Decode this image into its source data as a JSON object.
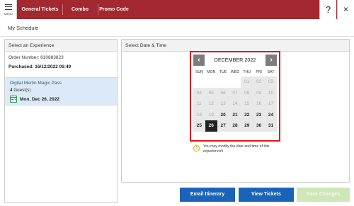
{
  "header": {
    "menu_label": "MENU",
    "tabs": [
      {
        "label": "General Tickets"
      },
      {
        "label": "Combo Tickets"
      },
      {
        "label": "Promo Code"
      }
    ],
    "help_label": "?",
    "close_label": "×"
  },
  "page": {
    "title": "My Schedule"
  },
  "left_panel": {
    "heading": "Select an Experience",
    "order_number": "Order Number: 610883823",
    "purchased": "Purchased: 16/12/2022 06:49",
    "experience": {
      "name": "Digital Merlin Magic Pass",
      "guest_count": "4",
      "guest_suffix": " Guest(s)",
      "date": "Mon, Dec 26, 2022"
    }
  },
  "right_panel": {
    "heading": "Select Date & Time",
    "calendar": {
      "month": "DECEMBER 2022",
      "prev": "‹",
      "next": "›",
      "weekdays": [
        "SUN",
        "MON",
        "TUE",
        "WED",
        "THU",
        "FRI",
        "SAT"
      ],
      "weeks": [
        [
          {
            "d": ""
          },
          {
            "d": ""
          },
          {
            "d": ""
          },
          {
            "d": ""
          },
          {
            "d": "01",
            "s": "disabled"
          },
          {
            "d": "02",
            "s": "disabled"
          },
          {
            "d": "03",
            "s": "disabled"
          }
        ],
        [
          {
            "d": "04",
            "s": "disabled"
          },
          {
            "d": "05",
            "s": "disabled"
          },
          {
            "d": "06",
            "s": "disabled"
          },
          {
            "d": "07",
            "s": "disabled"
          },
          {
            "d": "08",
            "s": "disabled"
          },
          {
            "d": "09",
            "s": "disabled"
          },
          {
            "d": "10",
            "s": "disabled"
          }
        ],
        [
          {
            "d": "11",
            "s": "disabled"
          },
          {
            "d": "12",
            "s": "disabled"
          },
          {
            "d": "13",
            "s": "disabled"
          },
          {
            "d": "14",
            "s": "disabled"
          },
          {
            "d": "15",
            "s": "disabled"
          },
          {
            "d": "16",
            "s": "disabled"
          },
          {
            "d": "17",
            "s": "disabled"
          }
        ],
        [
          {
            "d": "18",
            "s": "disabled"
          },
          {
            "d": "19",
            "s": "disabled"
          },
          {
            "d": "20",
            "s": "available"
          },
          {
            "d": "21",
            "s": "available"
          },
          {
            "d": "22",
            "s": "available"
          },
          {
            "d": "23",
            "s": "available"
          },
          {
            "d": "24",
            "s": "available"
          }
        ],
        [
          {
            "d": "25",
            "s": "available"
          },
          {
            "d": "26",
            "s": "selected"
          },
          {
            "d": "27",
            "s": "available"
          },
          {
            "d": "28",
            "s": "available"
          },
          {
            "d": "29",
            "s": "available"
          },
          {
            "d": "30",
            "s": "available"
          },
          {
            "d": "31",
            "s": "available"
          }
        ]
      ]
    },
    "info_text": "You may modify the date and time of this experience5"
  },
  "footer": {
    "email_label": "Email Itinerary",
    "view_label": "View Tickets",
    "save_label": "Save Changes"
  },
  "colors": {
    "header_bg": "#a4282f",
    "primary_button": "#1a63b8",
    "disabled_button": "#cfe7b8",
    "highlight_border": "#e01616",
    "selected_day": "#222222",
    "info_icon": "#e69c24"
  }
}
